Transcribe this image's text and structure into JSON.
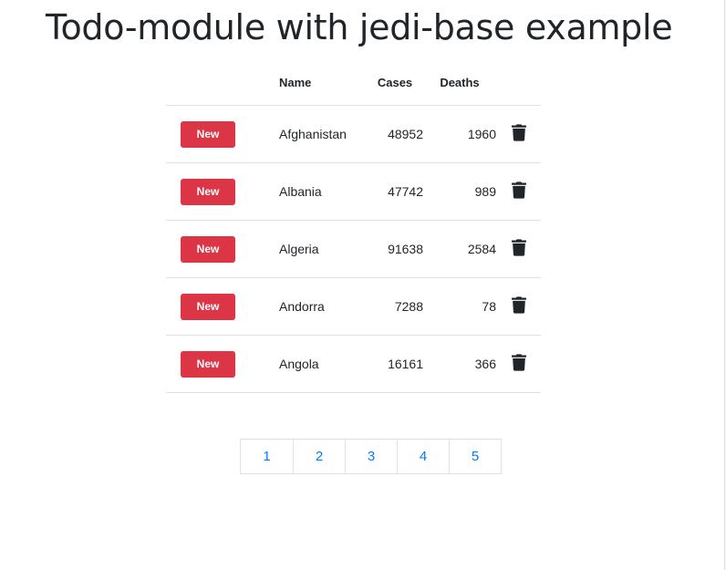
{
  "page": {
    "title": "Todo-module with jedi-base example"
  },
  "table": {
    "headers": {
      "name": "Name",
      "cases": "Cases",
      "deaths": "Deaths"
    },
    "rows": [
      {
        "button": "New",
        "name": "Afghanistan",
        "cases": "48952",
        "deaths": "1960",
        "action_icon": "trash-icon"
      },
      {
        "button": "New",
        "name": "Albania",
        "cases": "47742",
        "deaths": "989",
        "action_icon": "trash-icon"
      },
      {
        "button": "New",
        "name": "Algeria",
        "cases": "91638",
        "deaths": "2584",
        "action_icon": "trash-icon"
      },
      {
        "button": "New",
        "name": "Andorra",
        "cases": "7288",
        "deaths": "78",
        "action_icon": "trash-icon"
      },
      {
        "button": "New",
        "name": "Angola",
        "cases": "16161",
        "deaths": "366",
        "action_icon": "trash-icon"
      }
    ]
  },
  "pagination": {
    "pages": [
      "1",
      "2",
      "3",
      "4",
      "5"
    ]
  },
  "colors": {
    "new_button": "#dc3545",
    "link": "#007bff",
    "text": "#212529",
    "divider": "#dee2e6"
  }
}
